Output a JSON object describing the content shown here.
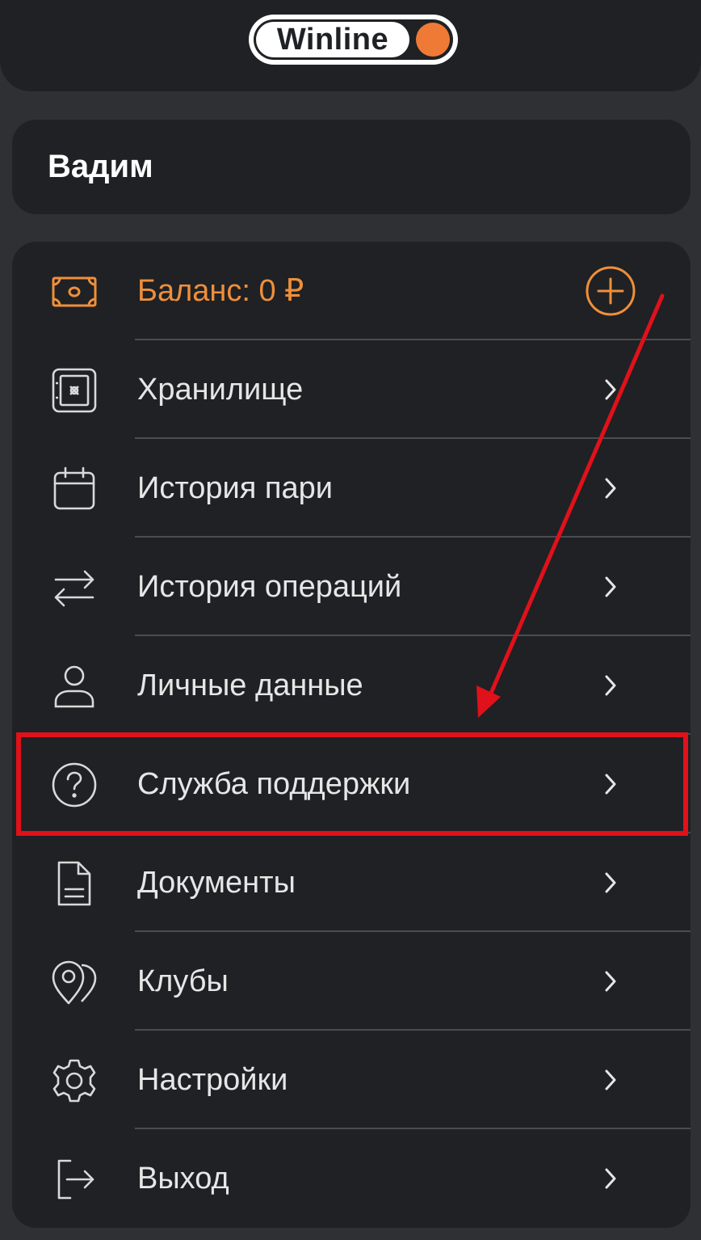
{
  "header": {
    "logo_text": "Winline",
    "brand_color": "#ef7a36"
  },
  "user": {
    "name": "Вадим"
  },
  "balance": {
    "label": "Баланс: 0 ₽",
    "icon": "banknote-icon",
    "action_icon": "plus-circle-icon"
  },
  "menu": {
    "items": [
      {
        "label": "Хранилище",
        "icon": "safe-icon"
      },
      {
        "label": "История пари",
        "icon": "calendar-icon"
      },
      {
        "label": "История операций",
        "icon": "arrows-swap-icon"
      },
      {
        "label": "Личные данные",
        "icon": "user-icon"
      },
      {
        "label": "Служба поддержки",
        "icon": "help-circle-icon",
        "highlighted": true
      },
      {
        "label": "Документы",
        "icon": "document-icon"
      },
      {
        "label": "Клубы",
        "icon": "map-pins-icon"
      },
      {
        "label": "Настройки",
        "icon": "gear-icon"
      },
      {
        "label": "Выход",
        "icon": "logout-icon"
      }
    ]
  },
  "colors": {
    "accent": "#ef8f3a",
    "annotation": "#e0111b",
    "card": "#1f2124",
    "background": "#2e3034"
  }
}
